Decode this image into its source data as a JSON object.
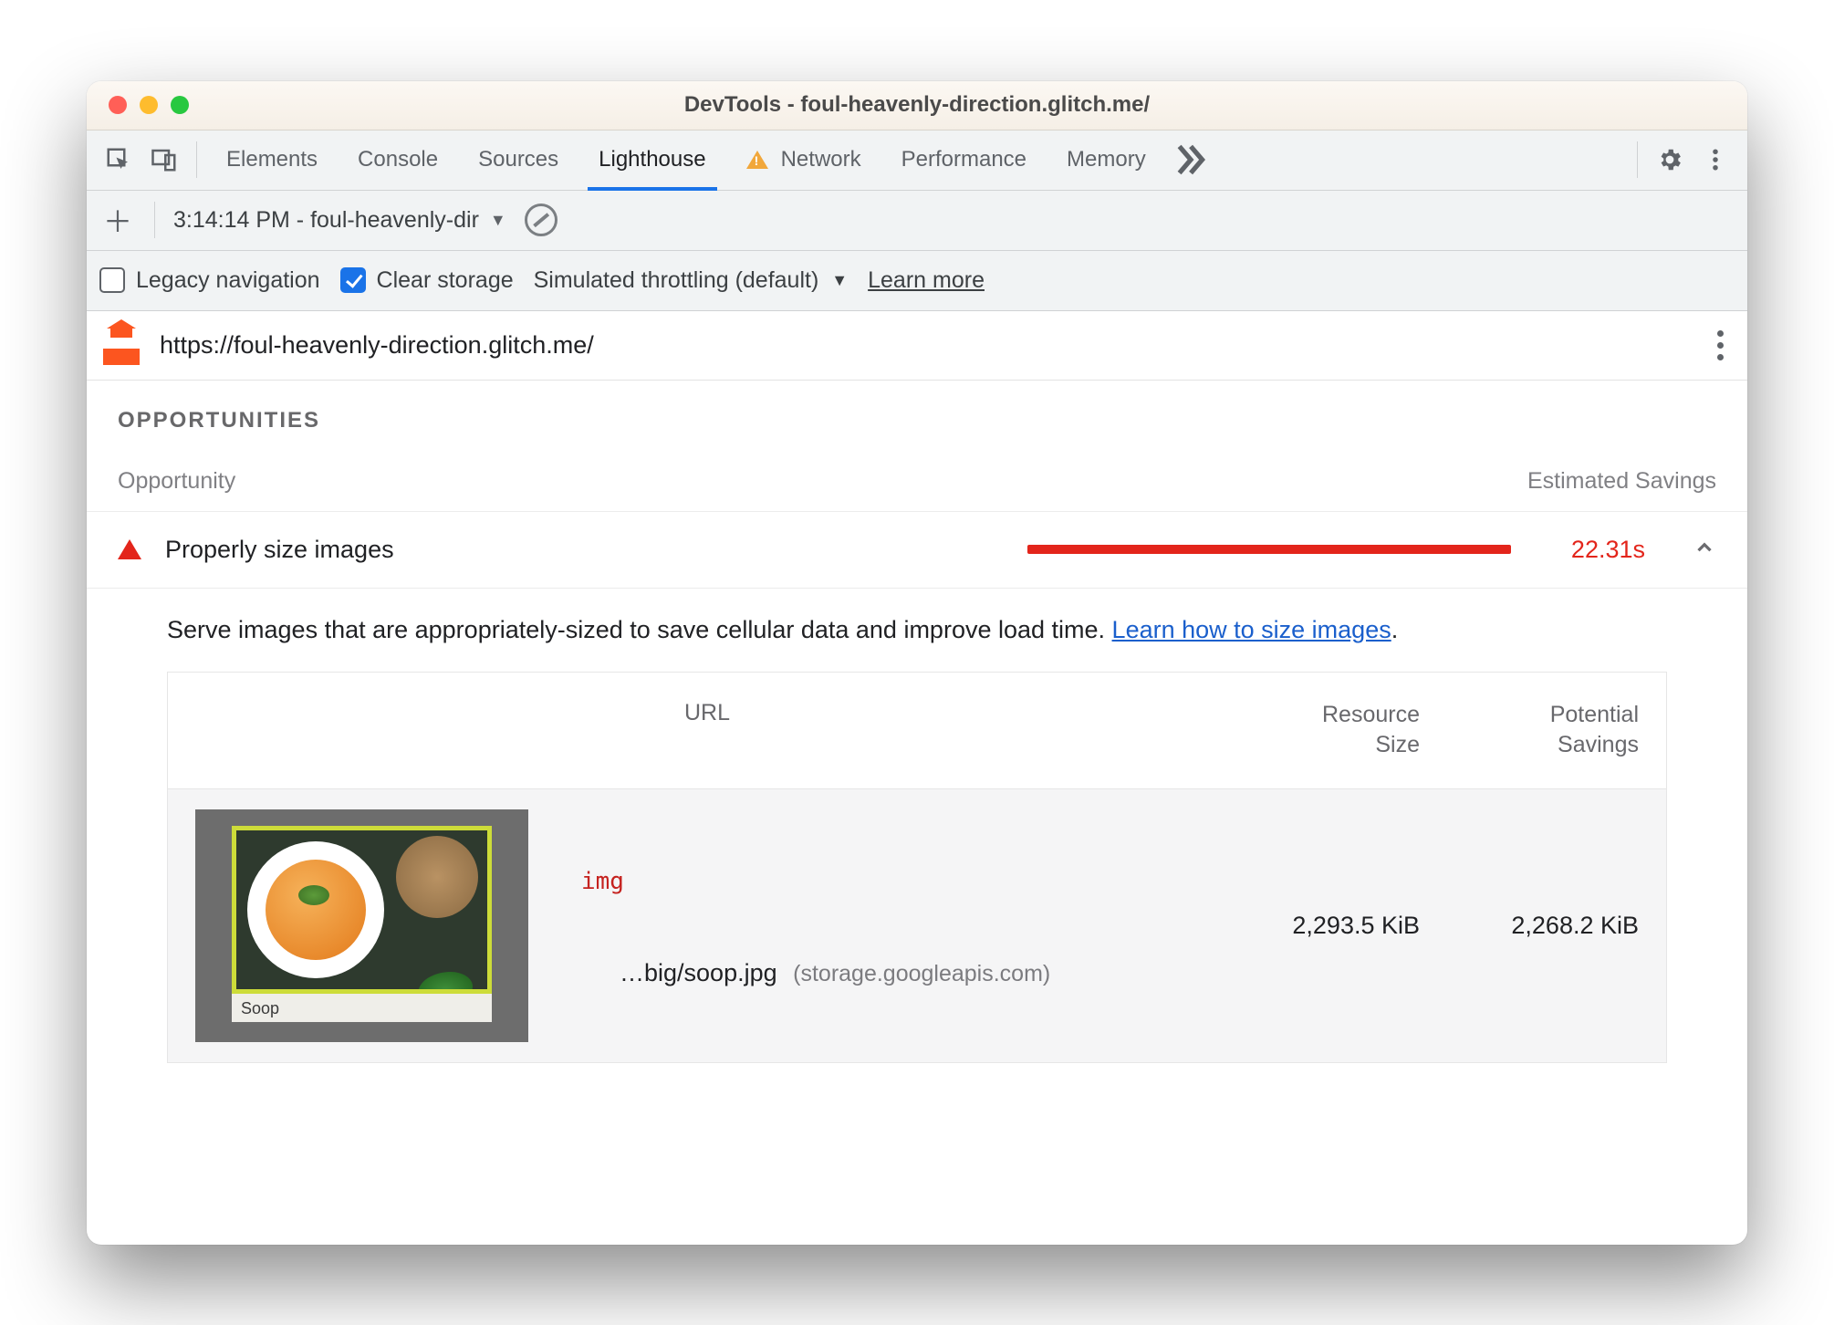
{
  "window": {
    "title": "DevTools - foul-heavenly-direction.glitch.me/"
  },
  "tabs": {
    "items": [
      "Elements",
      "Console",
      "Sources",
      "Lighthouse",
      "Network",
      "Performance",
      "Memory"
    ],
    "active": "Lighthouse",
    "network_has_warning": true
  },
  "subbar": {
    "report_label": "3:14:14 PM - foul-heavenly-dir"
  },
  "settingsbar": {
    "legacy_label": "Legacy navigation",
    "legacy_checked": false,
    "clear_label": "Clear storage",
    "clear_checked": true,
    "throttling_label": "Simulated throttling (default)",
    "learn_more": "Learn more"
  },
  "urlbar": {
    "url": "https://foul-heavenly-direction.glitch.me/"
  },
  "section": {
    "title": "OPPORTUNITIES",
    "col_opportunity": "Opportunity",
    "col_savings": "Estimated Savings"
  },
  "opportunity": {
    "name": "Properly size images",
    "savings_label": "22.31s",
    "description_pre": "Serve images that are appropriately-sized to save cellular data and improve load time. ",
    "description_link": "Learn how to size images",
    "description_post": "."
  },
  "table": {
    "head_url": "URL",
    "head_size_l1": "Resource",
    "head_size_l2": "Size",
    "head_save_l1": "Potential",
    "head_save_l2": "Savings",
    "rows": [
      {
        "tag": "img",
        "thumb_caption": "Soop",
        "url_short": "…big/soop.jpg",
        "url_host": "(storage.googleapis.com)",
        "resource_size": "2,293.5 KiB",
        "potential_savings": "2,268.2 KiB"
      }
    ]
  }
}
